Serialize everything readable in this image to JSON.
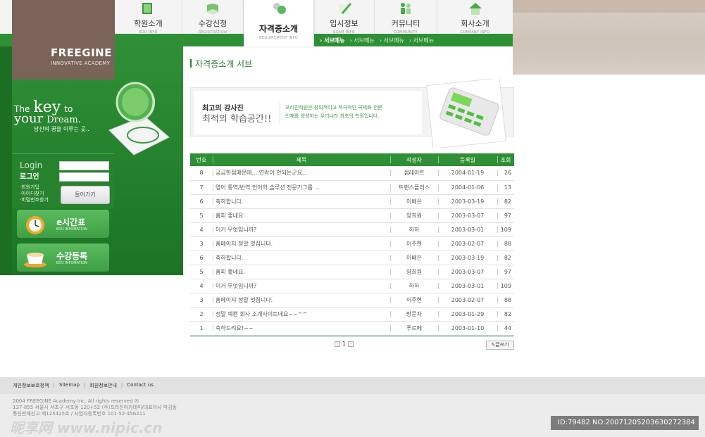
{
  "brand": {
    "name": "FREEGINE",
    "tagline": "INNOVATIVE ACADEMY"
  },
  "nav": [
    {
      "ko": "학원소개",
      "en": "EDU INFO",
      "icon": "book-icon"
    },
    {
      "ko": "수강신청",
      "en": "REGISTRATION",
      "icon": "open-book-icon"
    },
    {
      "ko": "자격증소개",
      "en": "REQUIREMENT INFO",
      "icon": "student-icon",
      "active": true
    },
    {
      "ko": "입시정보",
      "en": "EXAM INFO",
      "icon": "pen-icon"
    },
    {
      "ko": "커뮤니티",
      "en": "COMMUNITY",
      "icon": "people-icon"
    },
    {
      "ko": "회사소개",
      "en": "COMPANY INFO",
      "icon": "house-icon"
    }
  ],
  "subnav": [
    "› 서브메뉴",
    "› 서브메뉴",
    "› 서브메뉴",
    "› 서브메뉴"
  ],
  "hero": {
    "line1_a": "The",
    "line1_b": "key",
    "line1_c": "to",
    "line2_a": "your",
    "line2_b": "Dream.",
    "caption": "당신의 꿈을 이루는 곳.."
  },
  "login": {
    "title_en": "Login",
    "title_ko": "로그인",
    "links": [
      "·회원가입",
      "·아이디찾기",
      "·비밀번호찾기"
    ],
    "button": "들어가기"
  },
  "promos": [
    {
      "label": "e시간표",
      "sub": "EDU INFOMATION"
    },
    {
      "label": "수강등록",
      "sub": "EDU INFOMATION"
    }
  ],
  "page_title": "자격증소개 서브",
  "banner": {
    "heading": "최고의 강사진",
    "subheading": "최적의 학습공간!!",
    "text_line1": "프리진학원은 창의적이고 적극적인 국제화 전문",
    "text_line2": "인재를 양성하는 우리나라 최초의 학원입니다."
  },
  "board": {
    "headers": [
      "번호",
      "제목",
      "작성자",
      "등록일",
      "조회"
    ],
    "rows": [
      [
        "8",
        "궁금한점때문에....연락이 안되는군요...",
        "샘레이트",
        "2004-01-19",
        "26"
      ],
      [
        "7",
        "영어 통역/번역 언어학 솔루션 전문가그룹 ...",
        "트랜스플러스",
        "2004-01-06",
        "13"
      ],
      [
        "6",
        "축하합니다.",
        "이배은",
        "2003-03-19",
        "82"
      ],
      [
        "5",
        "홈피 좋네요.",
        "양희원",
        "2003-03-07",
        "97"
      ],
      [
        "4",
        "이거 무엇입니까?",
        "하하",
        "2003-03-01",
        "109"
      ],
      [
        "3",
        "홈페이지 정말 멋집니다.",
        "이주현",
        "2003-02-07",
        "88"
      ],
      [
        "6",
        "축하합니다.",
        "이배은",
        "2003-03-19",
        "82"
      ],
      [
        "5",
        "홈피 좋네요.",
        "양희원",
        "2003-03-07",
        "97"
      ],
      [
        "4",
        "이거 무엇입니까?",
        "하하",
        "2003-03-01",
        "109"
      ],
      [
        "3",
        "홈페이지 정말 멋집니다.",
        "이주현",
        "2003-02-07",
        "88"
      ],
      [
        "2",
        "정말 예쁜 회사 소개사이트네요~~^^",
        "방문자",
        "2003-01-29",
        "82"
      ],
      [
        "1",
        "축하드려요!~~",
        "푸르메",
        "2003-01-10",
        "44"
      ]
    ]
  },
  "pager": {
    "prev": "‹",
    "page": "1",
    "next": "›"
  },
  "write_button": "글쓰기",
  "footer": {
    "links": [
      "개인정보보호정책",
      "Sitemap",
      "회원정보안내",
      "Contact us"
    ],
    "copyright": "2004 FREEGINE Academy Inc. All rights reserved",
    "address": "137-855 서울시 서초구 서초동 120+52 (주)프리진아카데미/대표이사 박김동",
    "business": "통신판매신고 제125425호 / 사업자등록번호 101-52-456211"
  },
  "watermark": "昵享网 www.nipic.cn",
  "image_id": "ID:79482 NO:20071205203630272384",
  "colors": {
    "green": "#2f8f36",
    "dark_green": "#1b7424",
    "brown": "#7a6358",
    "tan": "#cfc3b8"
  }
}
